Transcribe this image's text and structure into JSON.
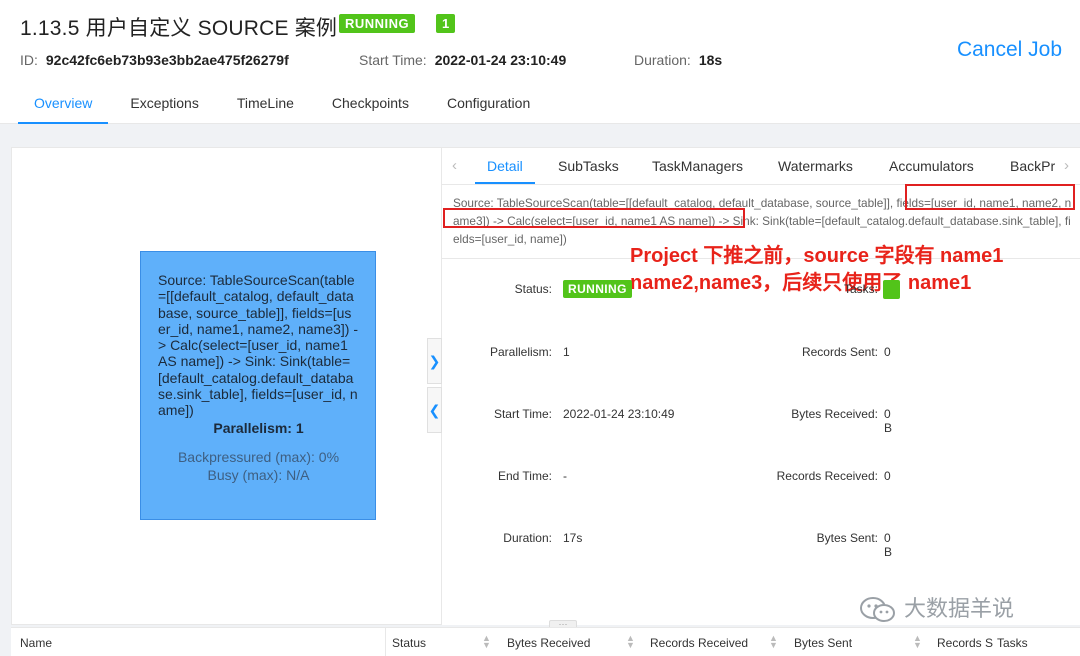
{
  "header": {
    "title": "1.13.5 用户自定义 SOURCE 案例",
    "status": "RUNNING",
    "task_count": "1",
    "id_label": "ID:",
    "id_value": "92c42fc6eb73b93e3bb2ae475f26279f",
    "start_label": "Start Time:",
    "start_value": "2022-01-24 23:10:49",
    "duration_label": "Duration:",
    "duration_value": "18s",
    "cancel_label": "Cancel Job"
  },
  "tabs": [
    "Overview",
    "Exceptions",
    "TimeLine",
    "Checkpoints",
    "Configuration"
  ],
  "node": {
    "description": "Source: TableSourceScan(table=[[default_catalog, default_database, source_table]], fields=[user_id, name1, name2, name3]) -> Calc(select=[user_id, name1 AS name]) -> Sink: Sink(table=[default_catalog.default_database.sink_table], fields=[user_id, name])",
    "parallelism": "Parallelism: 1",
    "backpressured": "Backpressured (max): 0%",
    "busy": "Busy (max): N/A"
  },
  "detail": {
    "tabs": [
      "Detail",
      "SubTasks",
      "TaskManagers",
      "Watermarks",
      "Accumulators",
      "BackPr"
    ],
    "description": "Source: TableSourceScan(table=[[default_catalog, default_database, source_table]], fields=[user_id, name1, name2, name3]) -> Calc(select=[user_id, name1 AS name]) -> Sink: Sink(table=[default_catalog.default_database.sink_table], fields=[user_id, name])",
    "annotation_line1": "Project 下推之前，source 字段有 name1",
    "annotation_line2": "name2,name3，后续只使用了 name1",
    "left_fields": [
      {
        "label": "Status",
        "value": "RUNNING"
      },
      {
        "label": "Parallelism",
        "value": "1"
      },
      {
        "label": "Start Time",
        "value": "2022-01-24 23:10:49"
      },
      {
        "label": "End Time",
        "value": "-"
      },
      {
        "label": "Duration",
        "value": "17s"
      }
    ],
    "right_fields": [
      {
        "label": "Tasks",
        "value": ""
      },
      {
        "label": "Records Sent",
        "value": "0"
      },
      {
        "label": "Bytes Received",
        "value": "0 B"
      },
      {
        "label": "Records Received",
        "value": "0"
      },
      {
        "label": "Bytes Sent",
        "value": "0 B"
      }
    ]
  },
  "table": {
    "columns": [
      "Name",
      "Status",
      "Bytes Received",
      "Records Received",
      "Bytes Sent",
      "Records S",
      "Tasks"
    ]
  },
  "watermark": "大数据羊说",
  "colors": {
    "accent": "#1890ff",
    "running": "#52c41a",
    "node": "#5fb0fa",
    "annotation": "#e8231a"
  }
}
